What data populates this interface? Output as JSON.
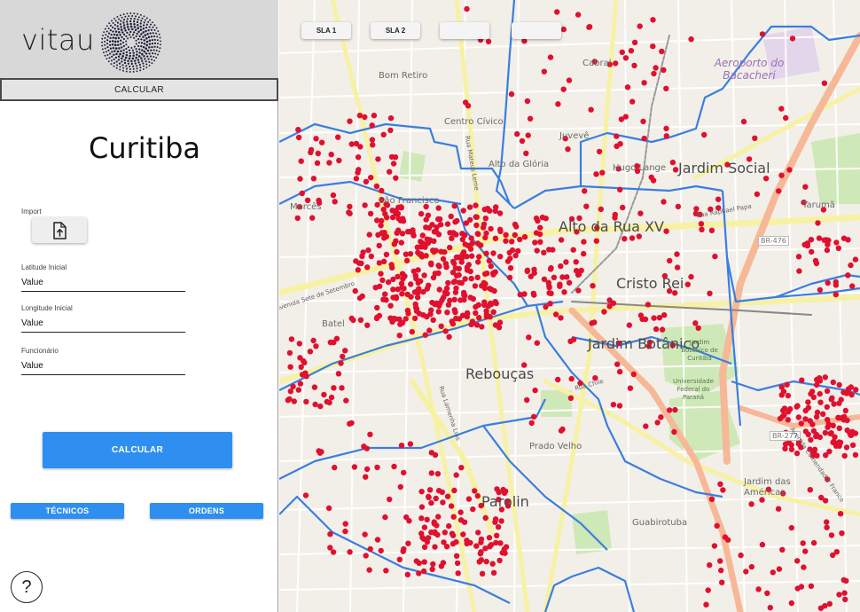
{
  "app": {
    "logo_text": "vitau",
    "top_calculate_label": "CALCULAR",
    "city_title": "Curitiba"
  },
  "form": {
    "import_label": "Import",
    "import_icon": "file-upload-icon",
    "latitude": {
      "label": "Latitude Inicial",
      "value": "Value"
    },
    "longitude": {
      "label": "Longitude Inicial",
      "value": "Value"
    },
    "employee": {
      "label": "Funcionário",
      "value": "Value"
    },
    "calculate_label": "CALCULAR"
  },
  "actions": {
    "technicians_label": "TÉCNICOS",
    "orders_label": "ORDENS",
    "help_symbol": "?"
  },
  "map": {
    "tabs": [
      "SLA 1",
      "SLA 2",
      "",
      ""
    ],
    "labels": {
      "alto_rua_xv": "Alto da Rua XV",
      "jardim_social": "Jardim Social",
      "cristo_rei": "Cristo Rei",
      "jardim_botanico": "Jardim Botânico",
      "reboucas": "Rebouças",
      "parolin": "Parolin",
      "airport": "Aeroporto do Bacacheri",
      "sao_francisco": "São Francisco",
      "merces": "Mercês",
      "bom_retiro": "Bom Retiro",
      "centro_civico": "Centro Cívico",
      "alto_gloria": "Alto da Glória",
      "juveve": "Juvevê",
      "hugo_lange": "Hugo Lange",
      "cabral": "Cabral",
      "taruma": "Tarumã",
      "batel": "Batel",
      "prado_velho": "Prado Velho",
      "guabirotuba": "Guabirotuba",
      "jardim_americas": "Jardim das Américas",
      "br476": "BR-476",
      "br277": "BR-277",
      "jardim_botanico_park": "Jardim Botânico de Curitiba",
      "universidade": "Universidade Federal do Paraná",
      "rua_chile": "Rua Chile",
      "av_sete_setembro": "Avenida Sete de Setembro",
      "rua_lamenha_lins": "Rua Lamenha Lins",
      "rua_mateus_leme": "Rua Mateus Leme",
      "rua_raphael_papa": "Rua Raphael Papa",
      "av_comendador": "Avenida Comendador Franco",
      "marker_color": "#e0102f",
      "boundary_color": "#3a7ee0"
    }
  }
}
